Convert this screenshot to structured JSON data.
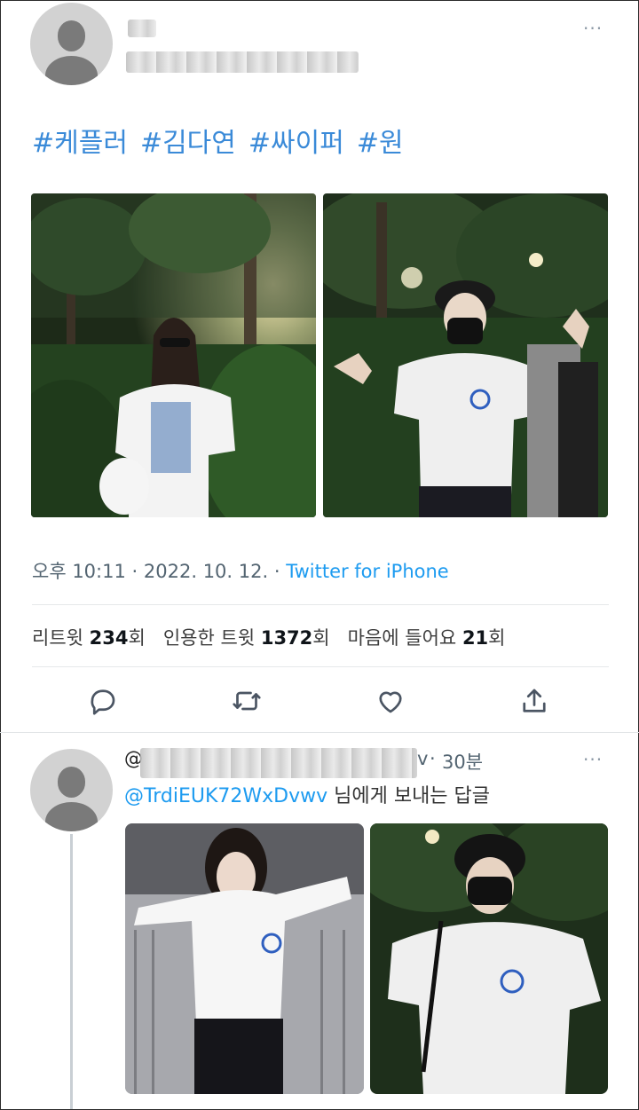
{
  "tweet": {
    "hashtags": [
      "#케플러",
      "#김다연",
      "#싸이퍼",
      "#원"
    ],
    "time": "오후 10:11",
    "date": "2022. 10. 12.",
    "separator": "·",
    "source": "Twitter for iPhone",
    "stats": {
      "retweets_label": "리트윗",
      "retweets_count": "234",
      "retweets_unit": "회",
      "quotes_label": "인용한 트윗",
      "quotes_count": "1372",
      "quotes_unit": "회",
      "likes_label": "마음에 들어요",
      "likes_count": "21",
      "likes_unit": "회"
    },
    "actions": [
      "reply-icon",
      "retweet-icon",
      "like-icon",
      "share-icon"
    ],
    "more": "···"
  },
  "reply": {
    "handle_prefix": "@",
    "handle_suffix": "v",
    "time": "30분",
    "separator": "·",
    "mention": "@TrdiEUK72WxDvwv",
    "reply_text": "님에게 보내는 답글",
    "more": "···"
  },
  "colors": {
    "accent": "#1d9bf0",
    "hashtag": "#3a8ad8",
    "muted": "#536471"
  }
}
